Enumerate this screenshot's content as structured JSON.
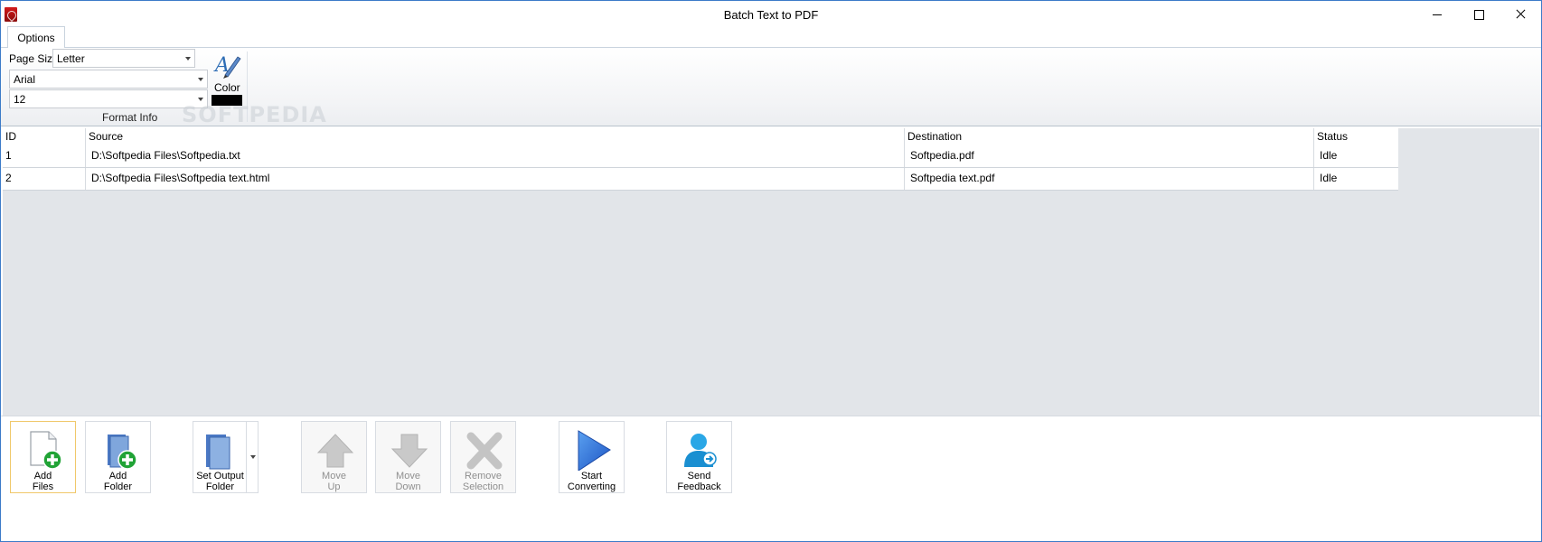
{
  "window": {
    "title": "Batch Text to PDF"
  },
  "ribbon": {
    "tab": "Options",
    "page_size_label": "Page Size",
    "page_size_value": "Letter",
    "font_value": "Arial",
    "font_size_value": "12",
    "color_label": "Color",
    "color_value": "#000000",
    "group_label": "Format Info",
    "watermark": "SOFTPEDIA"
  },
  "grid": {
    "columns": [
      "ID",
      "Source",
      "Destination",
      "Status"
    ],
    "rows": [
      {
        "id": "1",
        "source": "D:\\Softpedia Files\\Softpedia.txt",
        "destination": "Softpedia.pdf",
        "status": "Idle"
      },
      {
        "id": "2",
        "source": "D:\\Softpedia Files\\Softpedia text.html",
        "destination": "Softpedia text.pdf",
        "status": "Idle"
      }
    ]
  },
  "toolbar": {
    "add_files": [
      "Add",
      "Files"
    ],
    "add_folder": [
      "Add",
      "Folder"
    ],
    "set_output_folder": [
      "Set Output",
      "Folder"
    ],
    "move_up": [
      "Move",
      "Up"
    ],
    "move_down": [
      "Move",
      "Down"
    ],
    "remove_selection": [
      "Remove",
      "Selection"
    ],
    "start_converting": [
      "Start",
      "Converting"
    ],
    "send_feedback": [
      "Send",
      "Feedback"
    ]
  }
}
